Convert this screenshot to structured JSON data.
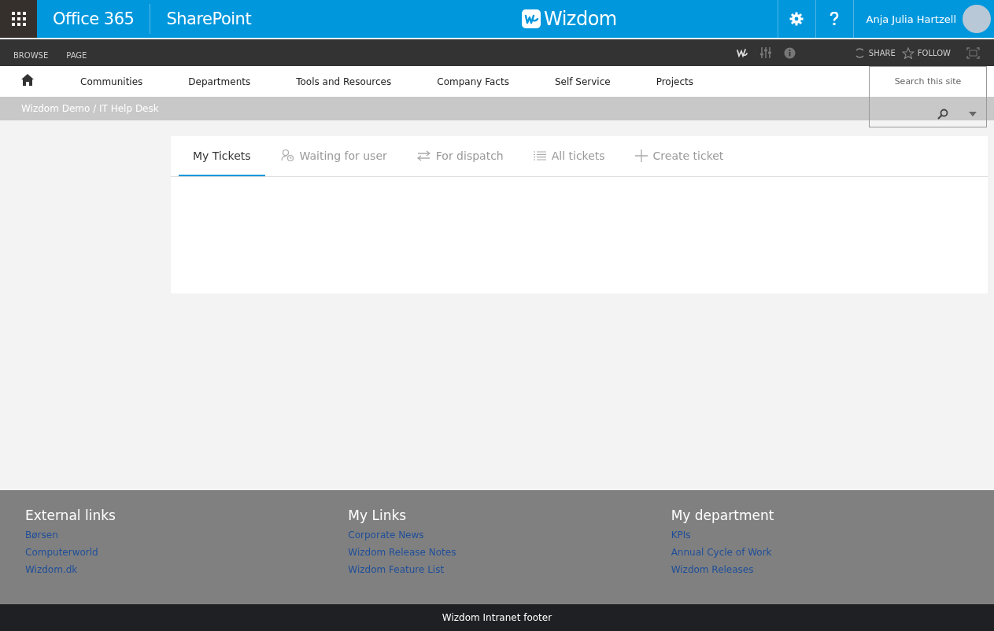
{
  "suite_bar": {
    "product": "Office 365",
    "app": "SharePoint",
    "logo_text": "Wizdom",
    "user_name": "Anja Julia Hartzell"
  },
  "ribbon": {
    "tabs": [
      {
        "label": "BROWSE"
      },
      {
        "label": "PAGE"
      }
    ],
    "actions": [
      {
        "kind": "share",
        "label": "SHARE"
      },
      {
        "kind": "follow",
        "label": "FOLLOW"
      }
    ]
  },
  "nav": {
    "items": [
      {
        "label": "Communities"
      },
      {
        "label": "Departments"
      },
      {
        "label": "Tools and Resources"
      },
      {
        "label": "Company Facts"
      },
      {
        "label": "Self Service"
      },
      {
        "label": "Projects"
      }
    ]
  },
  "search": {
    "placeholder": "Search this site"
  },
  "breadcrumb": "Wizdom Demo / IT Help Desk",
  "tabs": [
    {
      "kind": "none",
      "label": "My Tickets",
      "selected": true
    },
    {
      "kind": "waiting",
      "label": "Waiting for user",
      "selected": false
    },
    {
      "kind": "dispatch",
      "label": "For dispatch",
      "selected": false
    },
    {
      "kind": "list",
      "label": "All tickets",
      "selected": false
    },
    {
      "kind": "create",
      "label": "Create ticket",
      "selected": false
    }
  ],
  "footer": {
    "columns": [
      {
        "title": "External links",
        "links": [
          "Børsen",
          "Computerworld",
          "Wizdom.dk"
        ]
      },
      {
        "title": "My Links",
        "links": [
          "Corporate News",
          "Wizdom Release Notes",
          "Wizdom Feature List"
        ]
      },
      {
        "title": "My department",
        "links": [
          "KPIs",
          "Annual Cycle of Work",
          "Wizdom Releases"
        ]
      }
    ],
    "note": "Wizdom Intranet footer"
  }
}
